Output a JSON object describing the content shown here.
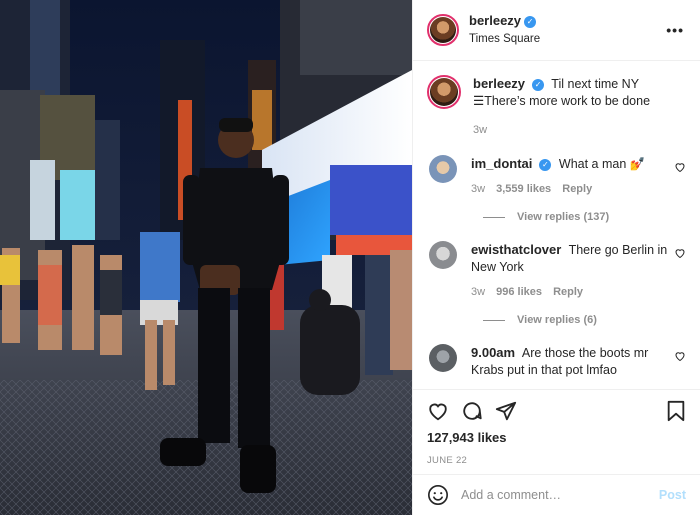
{
  "post": {
    "username": "berleezy",
    "location": "Times Square",
    "more_label": "•••"
  },
  "caption": {
    "username": "berleezy",
    "text": "Til next time NY ☰There’s more work to be done",
    "age": "3w"
  },
  "comments": [
    {
      "username": "im_dontai",
      "verified": true,
      "text": "What a man 💅",
      "age": "3w",
      "likes": "3,559 likes",
      "reply": "Reply",
      "view_replies": "View replies (137)",
      "avatar_color": "#7a94b8"
    },
    {
      "username": "ewisthatclover",
      "verified": false,
      "text": "There go Berlin in New York",
      "age": "3w",
      "likes": "996 likes",
      "reply": "Reply",
      "view_replies": "View replies (6)",
      "avatar_color": "#8a8c90"
    },
    {
      "username": "9.00am",
      "verified": false,
      "text": "Are those the boots mr Krabs put in that pot lmfao",
      "avatar_color": "#5b5f63"
    }
  ],
  "engagement": {
    "likes": "127,943 likes",
    "date": "JUNE 22"
  },
  "composer": {
    "placeholder": "Add a comment…",
    "post_label": "Post"
  },
  "icons": {
    "like": "heart-icon",
    "comment": "comment-bubble-icon",
    "share": "paper-plane-icon",
    "save": "bookmark-icon",
    "emoji": "smiley-icon",
    "verified": "verified-badge-icon",
    "more": "more-options-icon"
  },
  "colors": {
    "verified_blue": "#3897f0",
    "post_disabled": "#b2dffc",
    "muted_text": "#8e8e8e"
  }
}
